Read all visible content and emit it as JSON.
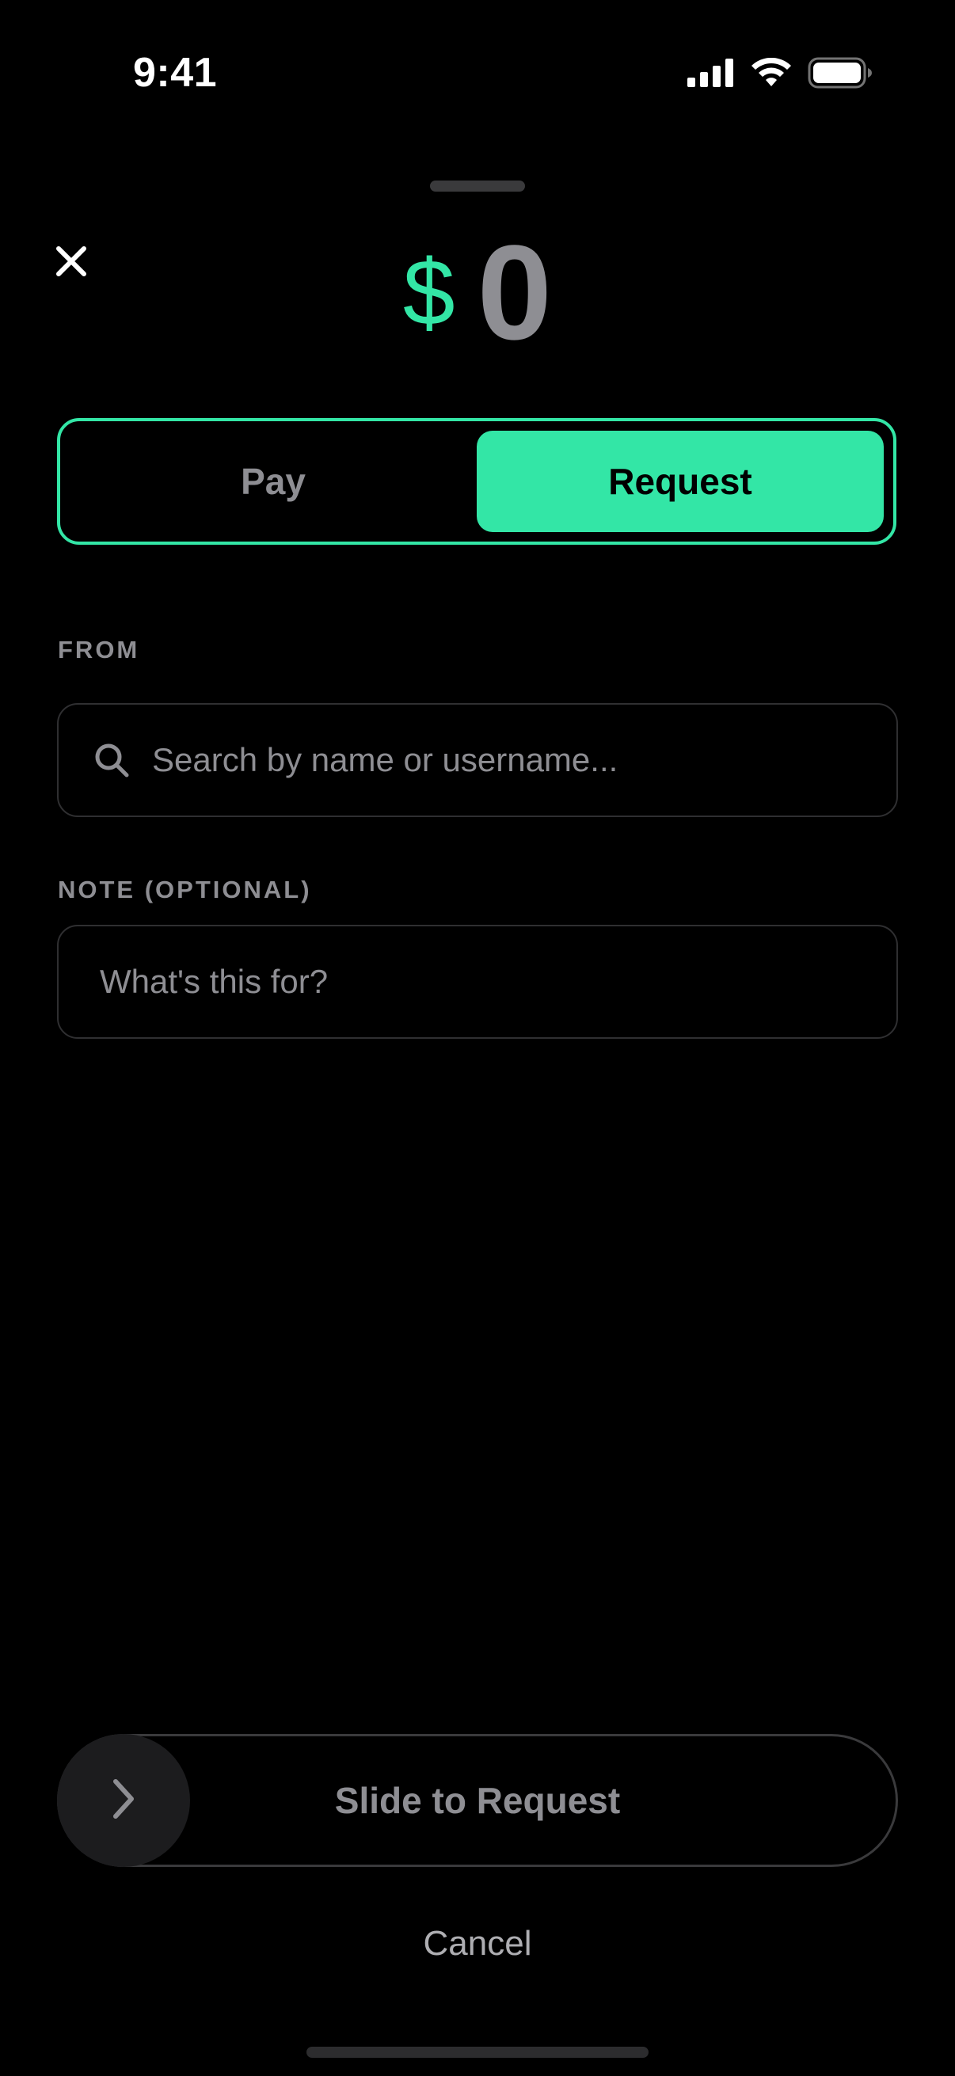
{
  "status_bar": {
    "time": "9:41",
    "icons": [
      "cellular-signal-icon",
      "wifi-icon",
      "battery-icon"
    ]
  },
  "header": {
    "close_icon": "close-icon",
    "currency_symbol": "$",
    "amount": "0"
  },
  "mode_toggle": {
    "options": [
      {
        "label": "Pay",
        "selected": false
      },
      {
        "label": "Request",
        "selected": true
      }
    ]
  },
  "from_field": {
    "label": "FROM",
    "placeholder": "Search by name or username...",
    "value": "",
    "icon": "search-icon"
  },
  "note_field": {
    "label": "NOTE (OPTIONAL)",
    "placeholder": "What's this for?",
    "value": ""
  },
  "slider": {
    "label": "Slide to Request",
    "icon": "chevron-right-icon",
    "progress": 0
  },
  "footer": {
    "cancel_label": "Cancel"
  },
  "colors": {
    "accent": "#33e6a6",
    "background": "#000000",
    "muted_text": "#8e8e93",
    "border": "#2f2f31"
  }
}
